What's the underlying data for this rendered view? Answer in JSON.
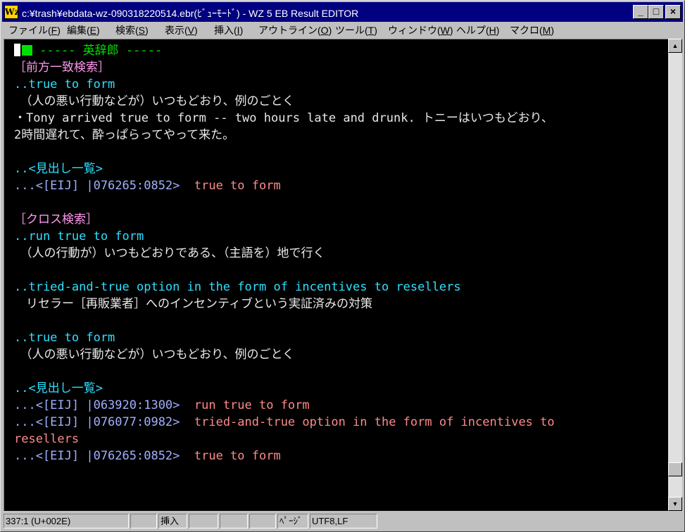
{
  "window": {
    "title": "c:¥trash¥ebdata-wz-090318220514.ebr(ﾋﾞｭｰﾓｰﾄﾞ) - WZ 5 EB Result EDITOR",
    "icon_label": "Wz",
    "buttons": {
      "minimize": "_",
      "maximize": "□",
      "close": "×"
    }
  },
  "menu": [
    {
      "label": "ファイル(",
      "key": "F",
      "end": ")"
    },
    {
      "label": "編集(",
      "key": "E",
      "end": ")"
    },
    {
      "label": "検索(",
      "key": "S",
      "end": ")"
    },
    {
      "label": "表示(",
      "key": "V",
      "end": ")"
    },
    {
      "label": "挿入(",
      "key": "I",
      "end": ")"
    },
    {
      "label": "アウトライン(",
      "key": "O",
      "end": ")"
    },
    {
      "label": "ツール(",
      "key": "T",
      "end": ")"
    },
    {
      "label": "ウィンドウ(",
      "key": "W",
      "end": ")"
    },
    {
      "label": "ヘルプ(",
      "key": "H",
      "end": ")"
    },
    {
      "label": "マクロ(",
      "key": "M",
      "end": ")"
    }
  ],
  "editor": {
    "header": " ----- 英辞郎 -----",
    "section1": "［前方一致検索］",
    "entry1_head": "..true to form",
    "entry1_def": "　（人の悪い行動などが）いつもどおり、例のごとく",
    "entry1_ex1": "・Tony arrived true to form -- two hours late and drunk. トニーはいつもどおり、",
    "entry1_ex2": "2時間遅れて、酔っぱらってやって来た。",
    "list1_head": "..<見出し一覧>",
    "list1_r1_ref": "...<[EIJ] |076265:0852>",
    "list1_r1_text": "  true to form",
    "section2": "［クロス検索］",
    "entry2_head": "..run true to form",
    "entry2_def": "　（人の行動が）いつもどおりである、（主語を）地で行く",
    "entry3_head": "..tried-and-true option in the form of incentives to resellers",
    "entry3_def": "　リセラー［再販業者］へのインセンティブという実証済みの対策",
    "entry4_head": "..true to form",
    "entry4_def": "　（人の悪い行動などが）いつもどおり、例のごとく",
    "list2_head": "..<見出し一覧>",
    "list2_r1_ref": "...<[EIJ] |063920:1300>",
    "list2_r1_text": "  run true to form",
    "list2_r2_ref": "...<[EIJ] |076077:0982>",
    "list2_r2_text": "  tried-and-true option in the form of incentives to",
    "list2_r2_wrap": "resellers",
    "list2_r3_ref": "...<[EIJ] |076265:0852>",
    "list2_r3_text": "  true to form"
  },
  "status": {
    "position": "337:1 (U+002E)",
    "insert": "挿入",
    "page": "ﾍﾟｰｼﾞ",
    "encoding": "UTF8,LF"
  },
  "colors": {
    "titlebar": "#000080",
    "editor_bg": "#000000",
    "cyan": "#2ee0ff",
    "pink": "#ff99ee",
    "green": "#00e000",
    "salmon": "#ff8a8a"
  }
}
